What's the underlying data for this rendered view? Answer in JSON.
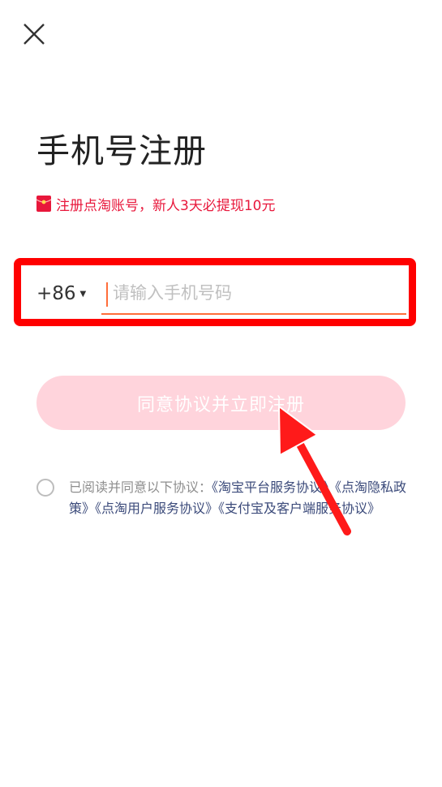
{
  "header": {
    "close_icon": "close-icon"
  },
  "title": "手机号注册",
  "promo": {
    "icon": "red-envelope-icon",
    "text": "注册点淘账号，新人3天必提现10元",
    "color": "#e8173b"
  },
  "phone": {
    "country_code": "+86",
    "placeholder": "请输入手机号码",
    "value": ""
  },
  "submit": {
    "label": "同意协议并立即注册",
    "color": "#ffd4dc"
  },
  "agreement": {
    "checked": false,
    "prefix": "已阅读并同意以下协议：",
    "links": [
      "《淘宝平台服务协议》",
      "《点淘隐私政策》",
      "《点淘用户服务协议》",
      "《支付宝及客户端服务协议》"
    ]
  },
  "annotation": {
    "highlight_color": "#ff0000",
    "arrow_color": "#ff1a1a"
  }
}
